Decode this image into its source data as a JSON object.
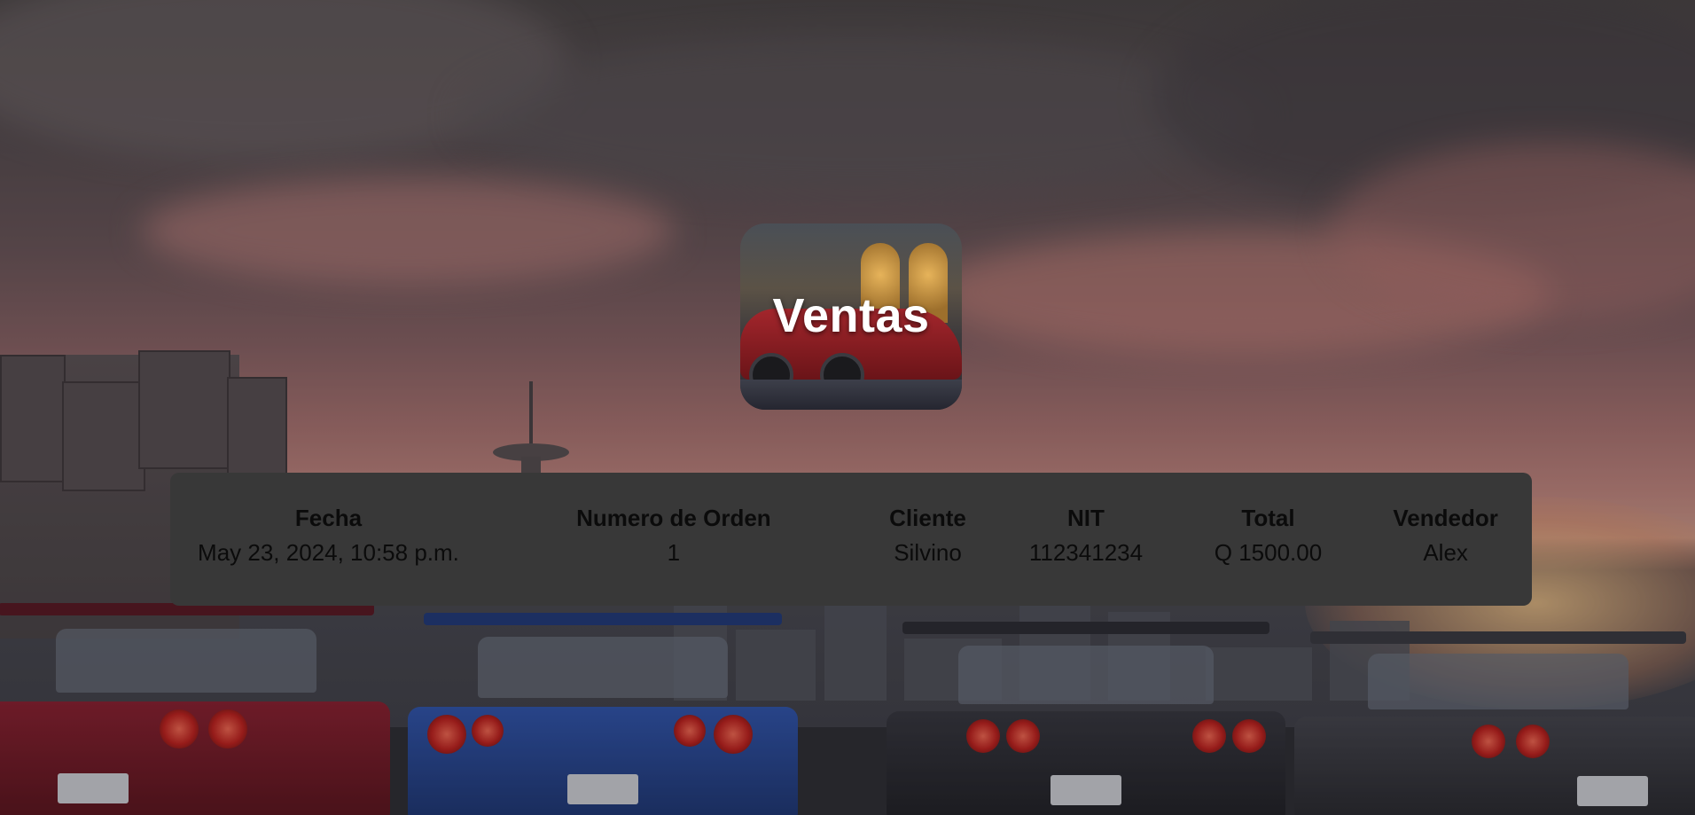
{
  "header": {
    "title": "Ventas"
  },
  "table": {
    "columns": [
      "Fecha",
      "Numero de Orden",
      "Cliente",
      "NIT",
      "Total",
      "Vendedor"
    ],
    "rows": [
      {
        "fecha": "May 23, 2024, 10:58 p.m.",
        "numero_orden": "1",
        "cliente": "Silvino",
        "nit": "112341234",
        "total": "Q 1500.00",
        "vendedor": "Alex"
      }
    ]
  },
  "colors": {
    "panel_bg": "#383838",
    "title_text": "#ffffff",
    "table_text": "#0b0b0b"
  }
}
